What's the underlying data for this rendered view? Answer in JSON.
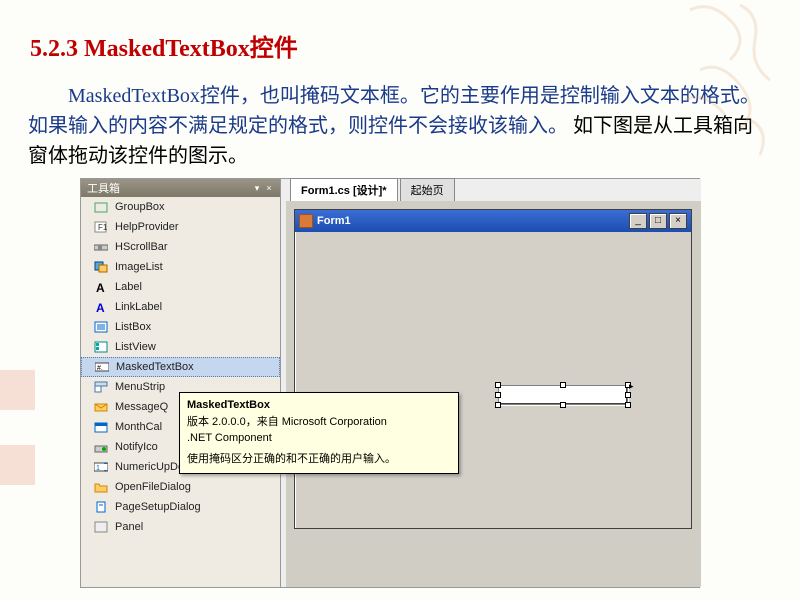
{
  "heading": "5.2.3 MaskedTextBox控件",
  "paragraph": {
    "p1_blue": "MaskedTextBox控件，也叫掩码文本框。它的主要作用是控制输入文本的格式。如果输入的内容不满足规定的格式，则控件不会接收该输入。",
    "p1_black": "  如下图是从工具箱向窗体拖动该控件的图示。"
  },
  "toolbox": {
    "title": "工具箱",
    "items": [
      {
        "icon": "groupbox",
        "label": "GroupBox"
      },
      {
        "icon": "helpprovider",
        "label": "HelpProvider"
      },
      {
        "icon": "hscrollbar",
        "label": "HScrollBar"
      },
      {
        "icon": "imagelist",
        "label": "ImageList"
      },
      {
        "icon": "label",
        "label": "Label"
      },
      {
        "icon": "linklabel",
        "label": "LinkLabel"
      },
      {
        "icon": "listbox",
        "label": "ListBox"
      },
      {
        "icon": "listview",
        "label": "ListView"
      },
      {
        "icon": "maskedtextbox",
        "label": "MaskedTextBox",
        "selected": true
      },
      {
        "icon": "menustrip",
        "label": "MenuStrip"
      },
      {
        "icon": "messagequeue",
        "label": "MessageQ"
      },
      {
        "icon": "monthcalendar",
        "label": "MonthCal"
      },
      {
        "icon": "notifyicon",
        "label": "NotifyIco"
      },
      {
        "icon": "numericupdown",
        "label": "NumericUpDown"
      },
      {
        "icon": "openfiledialog",
        "label": "OpenFileDialog"
      },
      {
        "icon": "pagesetupdialog",
        "label": "PageSetupDialog"
      },
      {
        "icon": "panel",
        "label": "Panel"
      }
    ]
  },
  "designer": {
    "tab_active": "Form1.cs [设计]*",
    "tab_inactive": "起始页",
    "form_title": "Form1"
  },
  "tooltip": {
    "title": "MaskedTextBox",
    "line1": "版本 2.0.0.0，来自 Microsoft Corporation",
    "line2": ".NET Component",
    "line3": "使用掩码区分正确的和不正确的用户输入。"
  },
  "window_buttons": {
    "min": "_",
    "max": "□",
    "close": "×"
  }
}
